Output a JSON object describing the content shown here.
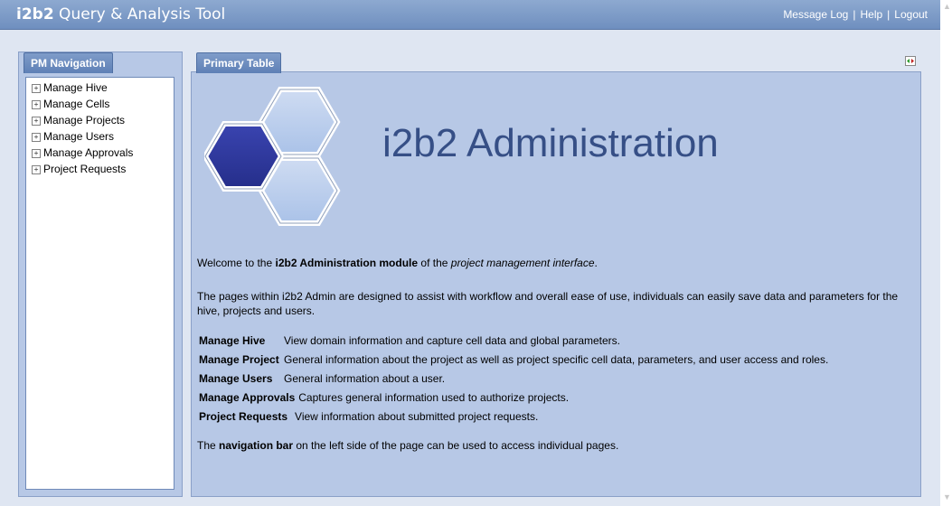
{
  "header": {
    "brand_bold": "i2b2",
    "brand_rest": " Query & Analysis Tool",
    "links": [
      "Message Log",
      "Help",
      "Logout"
    ],
    "separator": "|"
  },
  "nav": {
    "tab_label": "PM Navigation",
    "items": [
      {
        "toggle": "+",
        "label": "Manage Hive"
      },
      {
        "toggle": "+",
        "label": "Manage Cells"
      },
      {
        "toggle": "+",
        "label": "Manage Projects"
      },
      {
        "toggle": "+",
        "label": "Manage Users"
      },
      {
        "toggle": "+",
        "label": "Manage Approvals"
      },
      {
        "toggle": "+",
        "label": "Project Requests"
      }
    ]
  },
  "main": {
    "tab_label": "Primary Table",
    "logo_text": "i2b2 Administration",
    "welcome": {
      "pre": "Welcome to the ",
      "bold": "i2b2 Administration module",
      "mid": " of the ",
      "italic": "project management interface",
      "post": "."
    },
    "paragraph": "The pages within i2b2 Admin are designed to assist with workflow and overall ease of use, individuals can easily save data and parameters for the hive, projects and users.",
    "definitions": [
      {
        "term": "Manage Hive",
        "desc": "View domain information and capture cell data and global parameters."
      },
      {
        "term": "Manage Project",
        "desc": "General information about the project as well as project specific cell data, parameters, and user access and roles."
      },
      {
        "term": "Manage Users",
        "desc": "General information about a user."
      },
      {
        "term": "Manage Approvals",
        "desc": "Captures general information used to authorize projects."
      },
      {
        "term": "Project Requests",
        "desc": "View information about submitted project requests."
      }
    ],
    "footer": {
      "pre": "The ",
      "bold": "navigation bar",
      "post": " on the left side of the page can be used to access individual pages."
    }
  },
  "colors": {
    "header": "#7c9bc8",
    "panel": "#b7c8e6",
    "logo_text": "#364f86",
    "hex_dark": "#303aa0",
    "hex_light": "#bcd0ee"
  }
}
